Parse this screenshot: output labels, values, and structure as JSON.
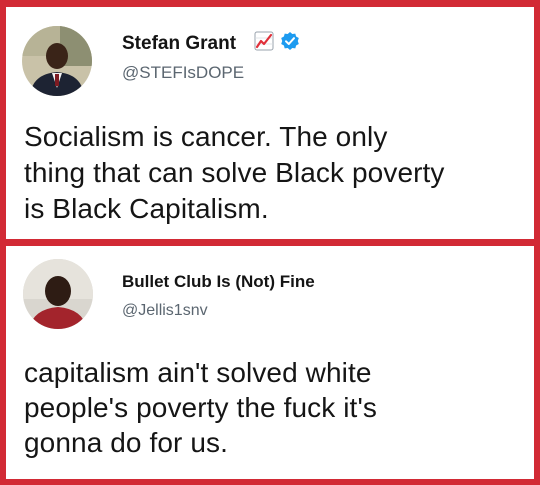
{
  "tweets": [
    {
      "author_name": "Stefan Grant",
      "handle": "@STEFIsDOPE",
      "lines": [
        "Socialism is cancer. The only",
        "thing that can solve Black poverty",
        "is Black Capitalism."
      ],
      "icons": [
        "trending-chart-emoji-icon",
        "verified-badge-icon"
      ]
    },
    {
      "author_name": "Bullet Club Is (Not) Fine",
      "handle": "@Jellis1snv",
      "lines": [
        "capitalism ain't solved white",
        "people's poverty the fuck it's",
        "gonna do for us."
      ]
    }
  ],
  "colors": {
    "frame_border": "#d22a35",
    "verified_blue": "#1d9bf0",
    "handle_gray": "#5b6670",
    "text": "#151515"
  }
}
